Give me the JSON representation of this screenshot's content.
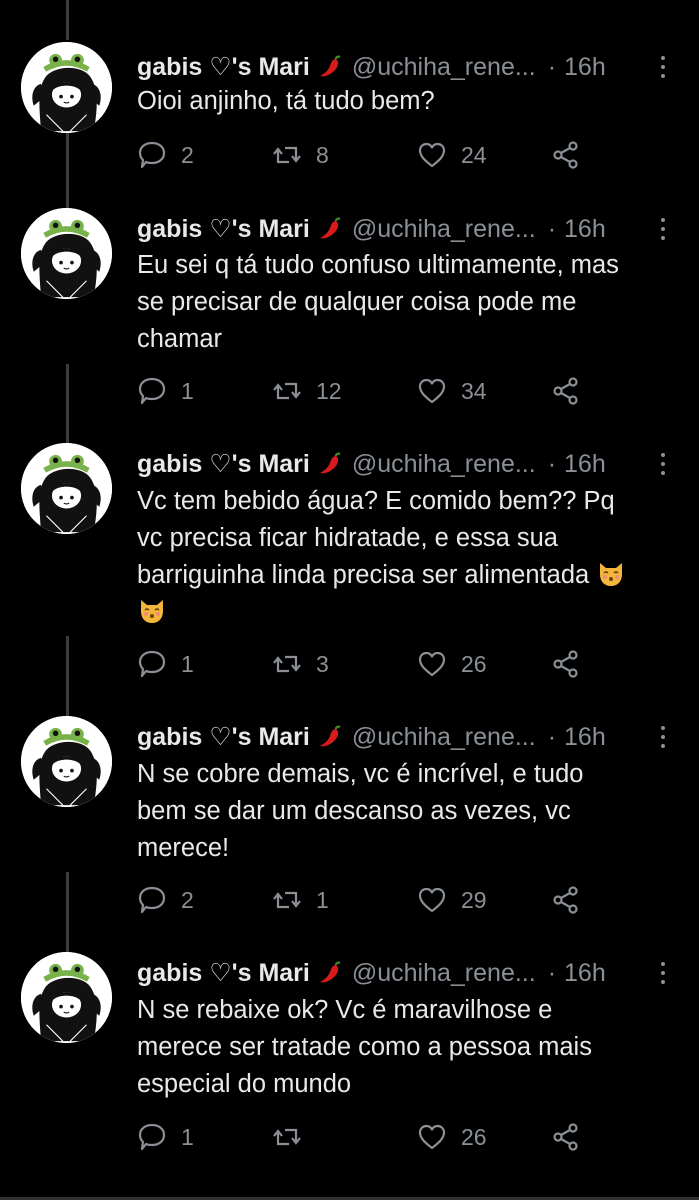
{
  "tweets": [
    {
      "name": "gabis ♡'s Mari",
      "handle": "@uchiha_rene...",
      "sep": "·",
      "time": "16h",
      "text_lines": [
        "Oioi anjinho, tá tudo bem?"
      ],
      "replies": "2",
      "retweets": "8",
      "likes": "24"
    },
    {
      "name": "gabis ♡'s Mari",
      "handle": "@uchiha_rene...",
      "sep": "·",
      "time": "16h",
      "text_lines": [
        "Eu sei q tá tudo confuso ultimamente, mas",
        "se precisar de qualquer coisa pode me",
        "chamar"
      ],
      "replies": "1",
      "retweets": "12",
      "likes": "34"
    },
    {
      "name": "gabis ♡'s Mari",
      "handle": "@uchiha_rene...",
      "sep": "·",
      "time": "16h",
      "text_lines": [
        "Vc tem bebido água? E comido bem?? Pq",
        "vc precisa ficar hidratade, e essa sua",
        "barriguinha linda precisa ser alimentada"
      ],
      "replies": "1",
      "retweets": "3",
      "likes": "26"
    },
    {
      "name": "gabis ♡'s Mari",
      "handle": "@uchiha_rene...",
      "sep": "·",
      "time": "16h",
      "text_lines": [
        "N se cobre demais, vc é incrível, e tudo",
        "bem se dar um descanso as vezes, vc",
        "merece!"
      ],
      "replies": "2",
      "retweets": "1",
      "likes": "29"
    },
    {
      "name": "gabis ♡'s Mari",
      "handle": "@uchiha_rene...",
      "sep": "·",
      "time": "16h",
      "text_lines": [
        "N se rebaixe ok? Vc é maravilhose e",
        "merece ser tratade como a pessoa mais",
        "especial do mundo"
      ],
      "replies": "1",
      "retweets": "",
      "likes": "26"
    }
  ],
  "icons": {
    "avatar": "avatar-frog-hat-icon",
    "chili": "chili-pepper-icon",
    "emoji": "kissing-cat-emoji-icon",
    "reply": "reply-icon",
    "retweet": "retweet-icon",
    "like": "heart-icon",
    "share": "share-icon",
    "more": "more-options-icon"
  },
  "colors": {
    "background": "#000000",
    "text": "#e7e9ea",
    "muted": "#8b9096",
    "chili": "#d81b1b"
  }
}
